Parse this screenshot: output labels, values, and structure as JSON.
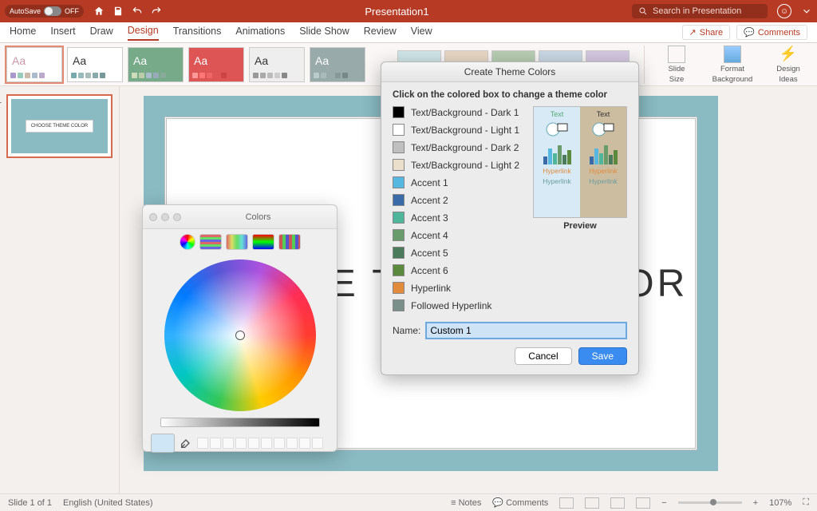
{
  "titlebar": {
    "autosave_label": "AutoSave",
    "autosave_state": "OFF",
    "document_title": "Presentation1",
    "search_placeholder": "Search in Presentation"
  },
  "tabs": {
    "items": [
      "Home",
      "Insert",
      "Draw",
      "Design",
      "Transitions",
      "Animations",
      "Slide Show",
      "Review",
      "View"
    ],
    "active_index": 3,
    "share_label": "Share",
    "comments_label": "Comments"
  },
  "ribbon": {
    "right_buttons": [
      {
        "label_line1": "Slide",
        "label_line2": "Size"
      },
      {
        "label_line1": "Format",
        "label_line2": "Background"
      },
      {
        "label_line1": "Design",
        "label_line2": "Ideas"
      }
    ]
  },
  "thumb": {
    "number": "1",
    "card_text": "CHOOSE THEME COLOR"
  },
  "slide": {
    "title": "CHOOSE THEME COLOR"
  },
  "dialog": {
    "title": "Create Theme Colors",
    "instruction": "Click on the colored box to change a theme color",
    "rows": [
      {
        "label": "Text/Background - Dark 1",
        "color": "#000000"
      },
      {
        "label": "Text/Background - Light 1",
        "color": "#ffffff"
      },
      {
        "label": "Text/Background - Dark 2",
        "color": "#bfbfbf"
      },
      {
        "label": "Text/Background - Light 2",
        "color": "#eadfca"
      },
      {
        "label": "Accent 1",
        "color": "#56b8e0"
      },
      {
        "label": "Accent 2",
        "color": "#3a6aa8"
      },
      {
        "label": "Accent 3",
        "color": "#4fb59b"
      },
      {
        "label": "Accent 4",
        "color": "#6a9b6a"
      },
      {
        "label": "Accent 5",
        "color": "#4a7a5a"
      },
      {
        "label": "Accent 6",
        "color": "#5b8a3f"
      },
      {
        "label": "Hyperlink",
        "color": "#e28b3c"
      },
      {
        "label": "Followed Hyperlink",
        "color": "#7a8f8a"
      }
    ],
    "preview_text": "Text",
    "preview_hyperlink": "Hyperlink",
    "preview_label": "Preview",
    "name_label": "Name:",
    "name_value": "Custom 1",
    "cancel": "Cancel",
    "save": "Save"
  },
  "colors_panel": {
    "title": "Colors"
  },
  "status": {
    "slide_info": "Slide 1 of 1",
    "language": "English (United States)",
    "notes": "Notes",
    "comments": "Comments",
    "zoom": "107%"
  }
}
